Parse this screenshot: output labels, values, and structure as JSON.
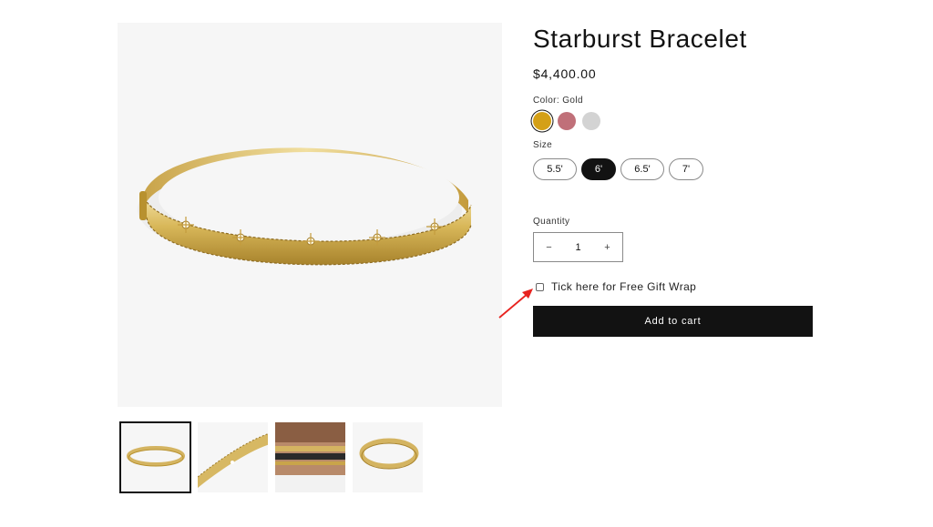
{
  "product": {
    "title": "Starburst Bracelet",
    "price": "$4,400.00"
  },
  "color": {
    "label": "Color: Gold",
    "options": [
      {
        "name": "Gold",
        "hex": "#d4a017",
        "selected": true
      },
      {
        "name": "Rose",
        "hex": "#c07079",
        "selected": false
      },
      {
        "name": "Silver",
        "hex": "#d3d3d3",
        "selected": false
      }
    ]
  },
  "size": {
    "label": "Size",
    "options": [
      {
        "label": "5.5'",
        "selected": false
      },
      {
        "label": "6'",
        "selected": true
      },
      {
        "label": "6.5'",
        "selected": false
      },
      {
        "label": "7'",
        "selected": false
      }
    ]
  },
  "quantity": {
    "label": "Quantity",
    "minus": "−",
    "value": "1",
    "plus": "+"
  },
  "gift_wrap": {
    "label": "Tick here for Free Gift Wrap",
    "checked": false
  },
  "cart": {
    "button_label": "Add to cart"
  },
  "annotation": {
    "arrow_color": "#e8231f"
  },
  "gallery": {
    "thumbnails": [
      {
        "name": "bracelet-front",
        "selected": true
      },
      {
        "name": "bracelet-closeup",
        "selected": false
      },
      {
        "name": "bracelet-worn",
        "selected": false
      },
      {
        "name": "bracelet-angle",
        "selected": false
      }
    ]
  }
}
